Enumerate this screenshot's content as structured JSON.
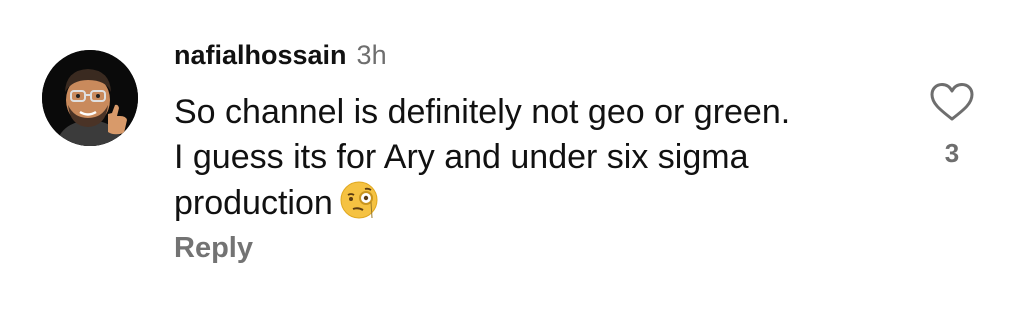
{
  "comment": {
    "username": "nafialhossain",
    "timestamp": "3h",
    "text_lines": [
      "So channel is definitely not geo or green.",
      "I guess its for Ary and under six sigma",
      "production"
    ],
    "emoji": "face-with-monocle",
    "reply_label": "Reply",
    "like_count": "3",
    "like_icon": "heart-outline-icon"
  }
}
